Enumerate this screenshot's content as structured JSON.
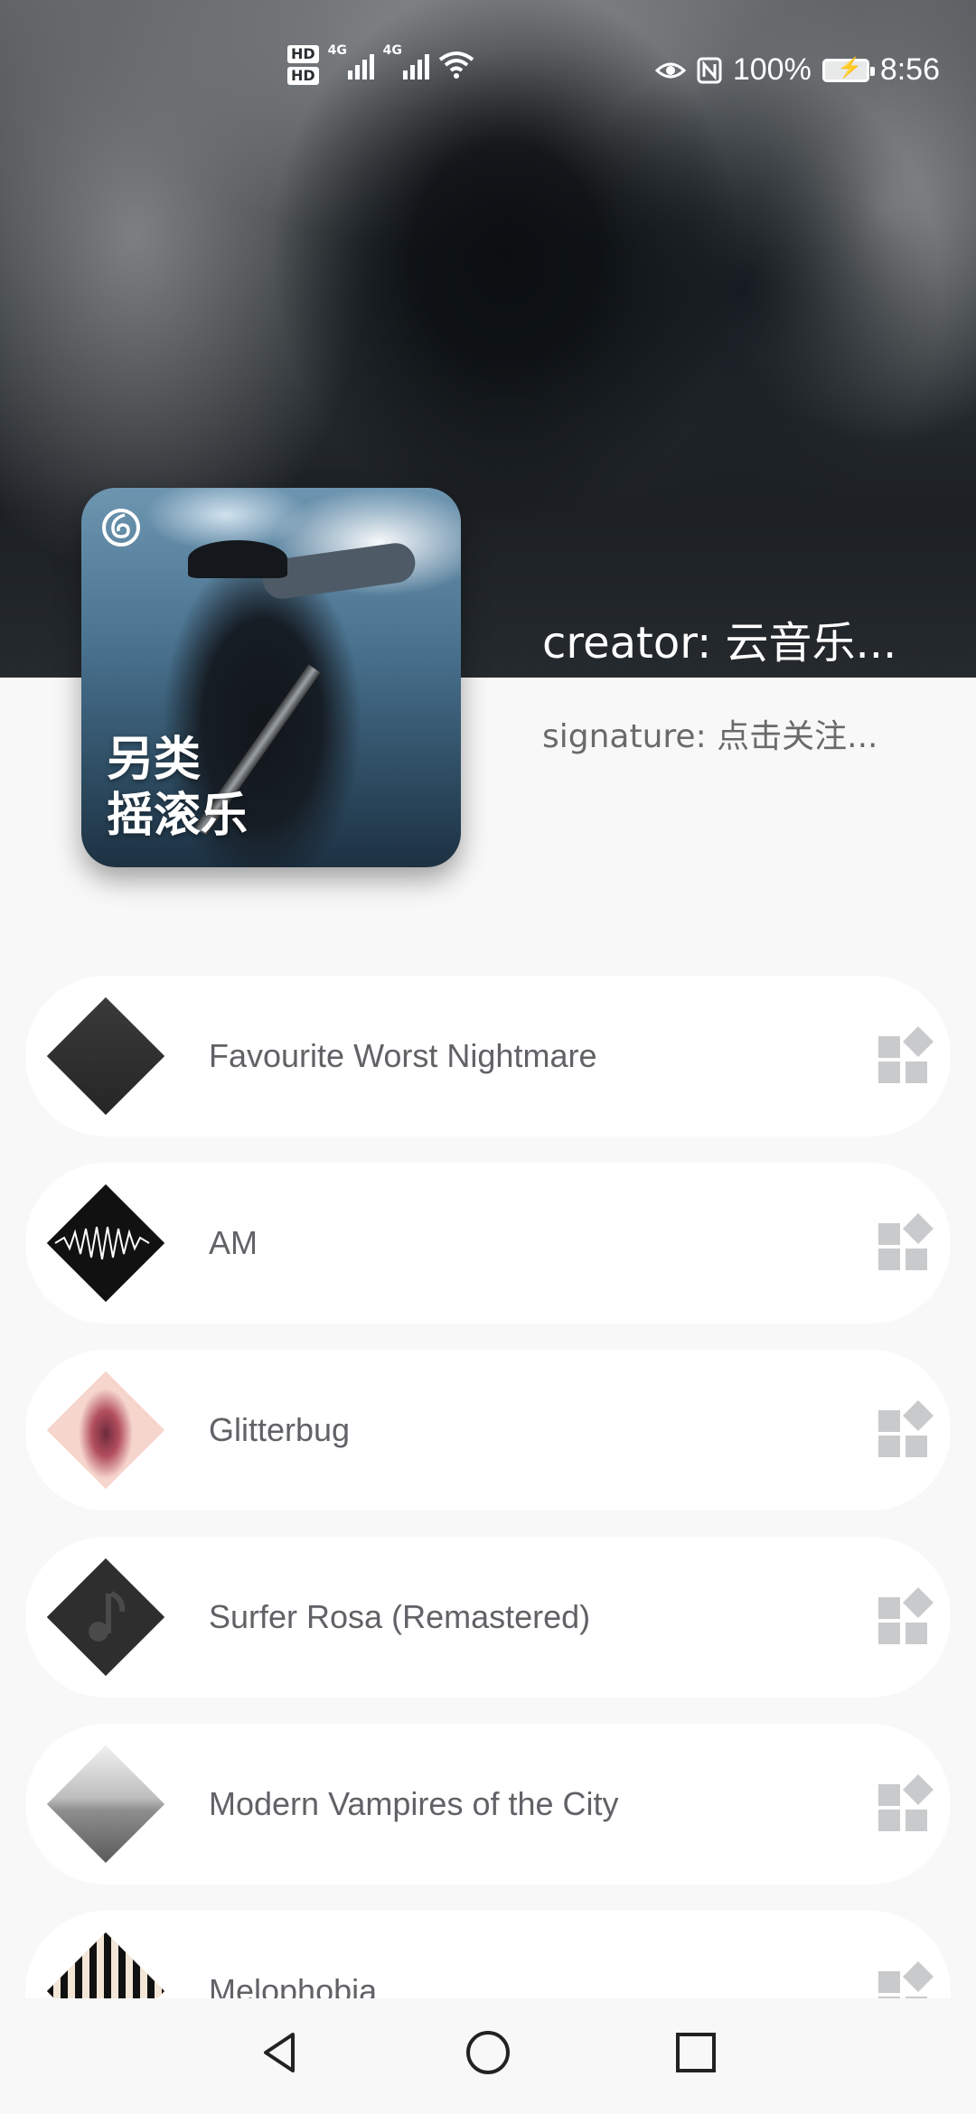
{
  "status_bar": {
    "hd1": "HD",
    "hd2": "HD",
    "net1": "4G",
    "net2": "4G",
    "battery_percent": "100%",
    "time": "8:56"
  },
  "playlist": {
    "cover_title_line1": "另类",
    "cover_title_line2": "摇滚乐",
    "creator": "creator: 云音乐...",
    "signature": "signature: 点击关注..."
  },
  "tracks": [
    {
      "title": "Favourite Worst Nightmare"
    },
    {
      "title": "AM"
    },
    {
      "title": "Glitterbug"
    },
    {
      "title": "Surfer Rosa (Remastered)"
    },
    {
      "title": "Modern Vampires of the City"
    },
    {
      "title": "Melophobia"
    }
  ],
  "colors": {
    "background": "#f8f8f8",
    "card": "#ffffff",
    "label": "#606266",
    "icon_grey": "#c9cacc"
  }
}
